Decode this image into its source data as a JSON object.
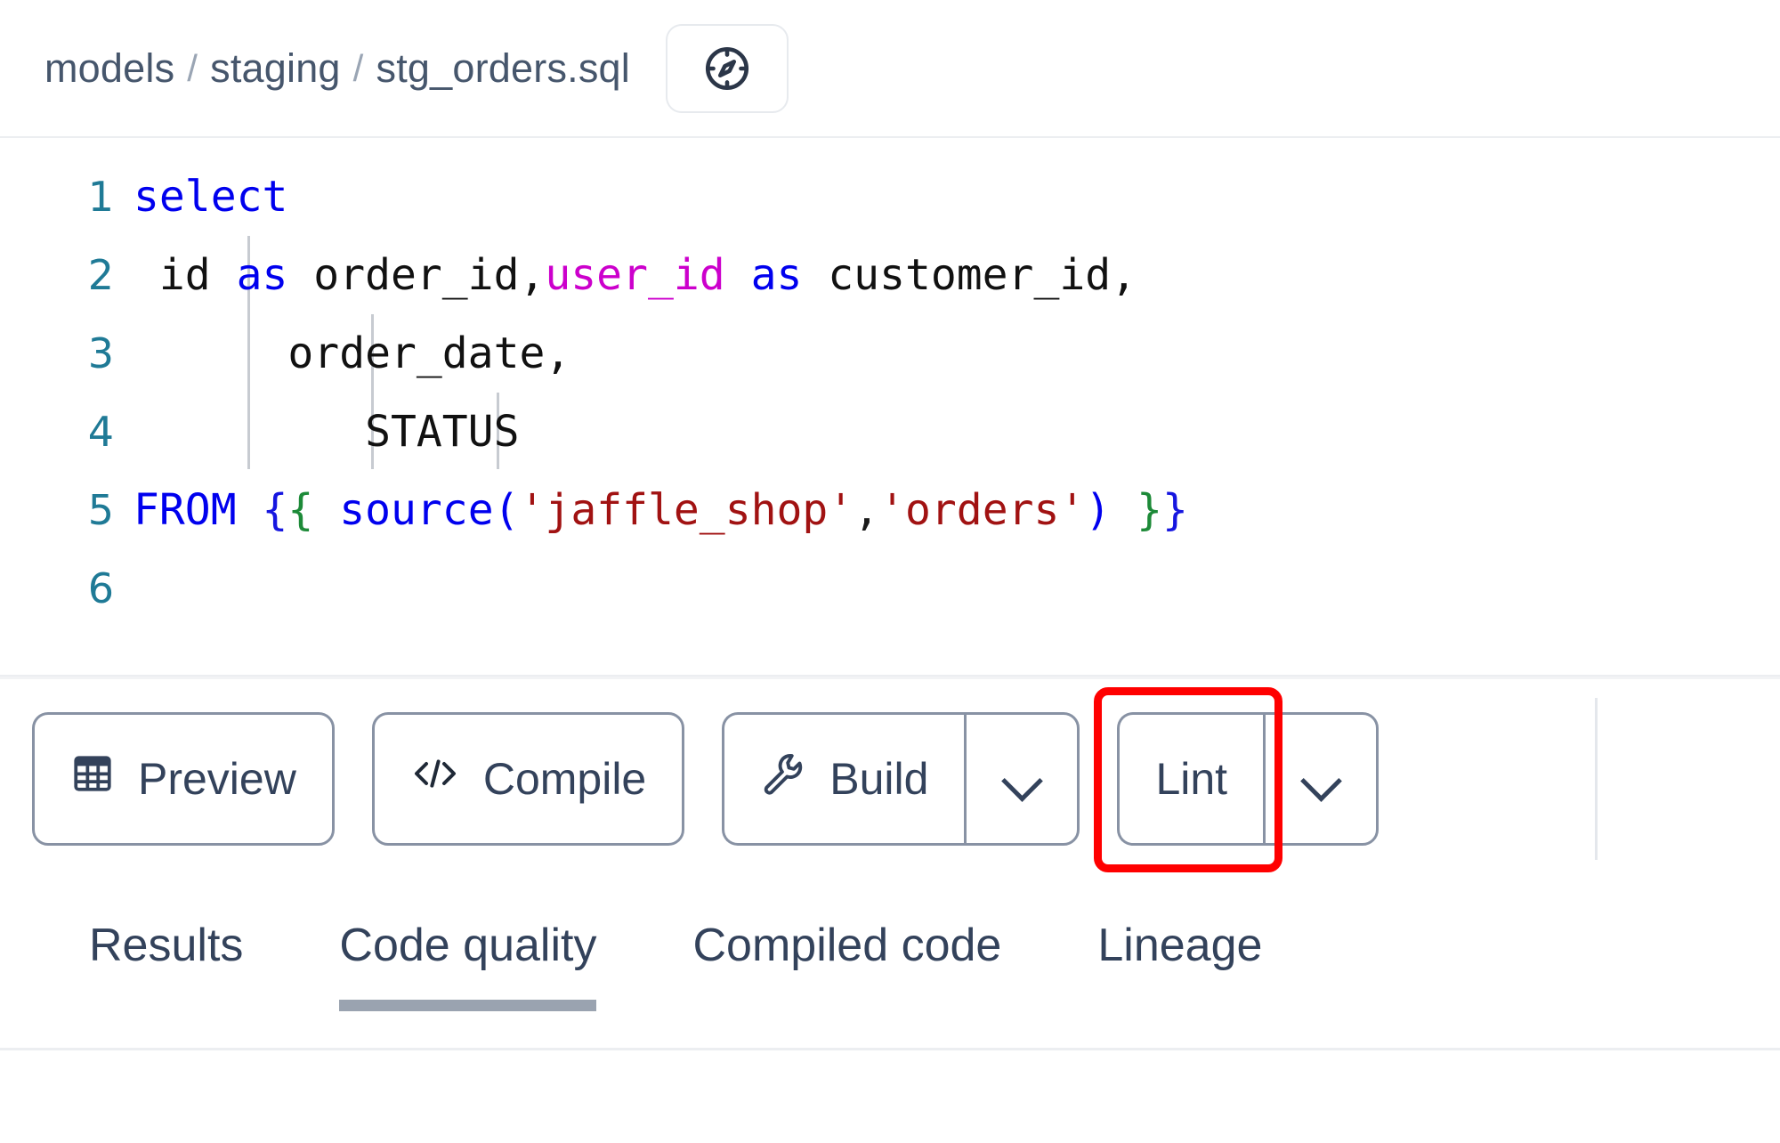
{
  "breadcrumb": {
    "parts": [
      "models",
      "staging",
      "stg_orders.sql"
    ],
    "separator": "/",
    "compass_icon": "compass-icon"
  },
  "editor": {
    "lines": [
      {
        "number": "1",
        "text": "select"
      },
      {
        "number": "2",
        "text": " id as order_id,user_id as customer_id,"
      },
      {
        "number": "3",
        "text": "      order_date,"
      },
      {
        "number": "4",
        "text": "         STATUS"
      },
      {
        "number": "5",
        "text": "FROM {{ source('jaffle_shop','orders') }}"
      },
      {
        "number": "6",
        "text": ""
      }
    ],
    "line_numbers": [
      "1",
      "2",
      "3",
      "4",
      "5",
      "6"
    ],
    "tokens": {
      "l1_select": "select",
      "l2_id": " id ",
      "l2_as1": "as",
      "l2_order_id": " order_id,",
      "l2_user_id": "user_id",
      "l2_as2": " as ",
      "l2_customer_id": "customer_id,",
      "l3_order_date": "      order_date,",
      "l4_status": "         STATUS",
      "l5_from": "FROM ",
      "l5_open_b": "{",
      "l5_open_g": "{",
      "l5_source": " source",
      "l5_paren_open": "(",
      "l5_str1": "'jaffle_shop'",
      "l5_comma": ",",
      "l5_str2": "'orders'",
      "l5_paren_close": ")",
      "l5_close_g": " }",
      "l5_close_b": "}"
    },
    "colors": {
      "keyword": "#0000ee",
      "variable": "#cc00cc",
      "string": "#a11212",
      "jinja_brace_blue": "#1616e0",
      "jinja_brace_green": "#1d8a38",
      "line_number": "#1f7a96",
      "plain": "#111111"
    }
  },
  "toolbar": {
    "preview": {
      "label": "Preview",
      "icon": "table-icon"
    },
    "compile": {
      "label": "Compile",
      "icon": "code-brackets-icon"
    },
    "build": {
      "label": "Build",
      "icon": "wrench-icon",
      "caret_icon": "chevron-down-icon"
    },
    "lint": {
      "label": "Lint",
      "caret_icon": "chevron-down-icon",
      "highlight_color": "#ff0000"
    }
  },
  "tabs": {
    "items": [
      {
        "label": "Results",
        "active": false
      },
      {
        "label": "Code quality",
        "active": true
      },
      {
        "label": "Compiled code",
        "active": false
      },
      {
        "label": "Lineage",
        "active": false
      }
    ],
    "active_underline_color": "#9aa3b0"
  }
}
